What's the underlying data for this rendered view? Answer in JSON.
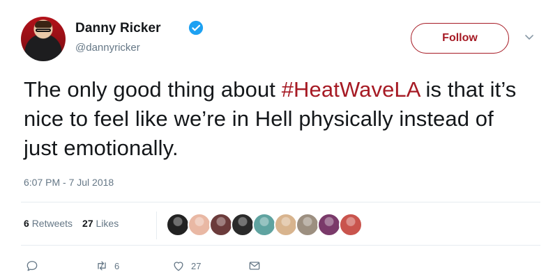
{
  "user": {
    "display_name": "Danny Ricker",
    "handle": "@dannyricker",
    "verified": true
  },
  "follow_button": {
    "label": "Follow"
  },
  "tweet": {
    "text_before": "The only good thing about ",
    "hashtag": "#HeatWaveLA",
    "text_after": " is that it’s nice to feel like we’re in Hell physically instead of just emotionally.",
    "timestamp": "6:07 PM - 7 Jul 2018"
  },
  "stats": {
    "retweets_count": "6",
    "retweets_label": "Retweets",
    "likes_count": "27",
    "likes_label": "Likes"
  },
  "likers": [
    {
      "name": "liker-avatar-1",
      "color": "#222222"
    },
    {
      "name": "liker-avatar-2",
      "color": "#e9b8a4"
    },
    {
      "name": "liker-avatar-3",
      "color": "#6b3b3b"
    },
    {
      "name": "liker-avatar-4",
      "color": "#2a2a2a"
    },
    {
      "name": "liker-avatar-5",
      "color": "#5fa3a0"
    },
    {
      "name": "liker-avatar-6",
      "color": "#d8b48e"
    },
    {
      "name": "liker-avatar-7",
      "color": "#9c8f80"
    },
    {
      "name": "liker-avatar-8",
      "color": "#7a3a6a"
    },
    {
      "name": "liker-avatar-9",
      "color": "#c9544d"
    }
  ],
  "actions": {
    "reply_icon": "reply-icon",
    "retweet_count": "6",
    "like_count": "27",
    "dm_icon": "direct-message-icon"
  },
  "colors": {
    "accent": "#a61a24",
    "verified": "#1da1f2",
    "secondary_text": "#657786"
  }
}
